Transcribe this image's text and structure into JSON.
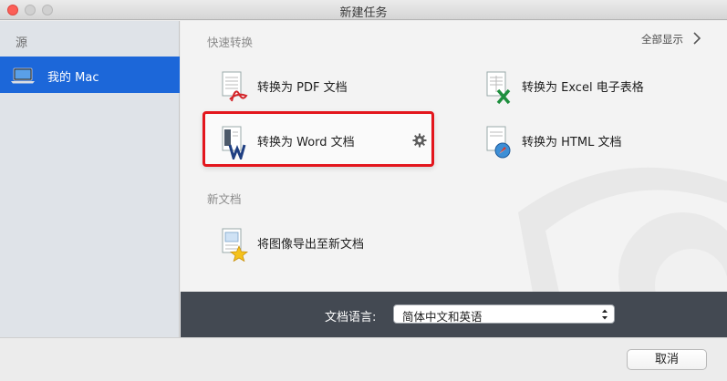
{
  "window": {
    "title": "新建任务"
  },
  "sidebar": {
    "header": "源",
    "items": [
      {
        "label": "我的 Mac",
        "icon": "macbook-icon",
        "selected": true
      }
    ]
  },
  "main": {
    "quick_convert": {
      "title": "快速转换",
      "show_all": "全部显示",
      "tasks": [
        {
          "label": "转换为 PDF 文档",
          "icon": "pdf-document-icon"
        },
        {
          "label": "转换为 Excel 电子表格",
          "icon": "excel-document-icon"
        },
        {
          "label": "转换为 Word 文档",
          "icon": "word-document-icon",
          "highlighted": true
        },
        {
          "label": "转换为 HTML 文档",
          "icon": "html-document-icon"
        }
      ]
    },
    "new_document": {
      "title": "新文档",
      "tasks": [
        {
          "label": "将图像导出至新文档",
          "icon": "image-export-icon"
        }
      ]
    }
  },
  "language": {
    "label": "文档语言:",
    "selected": "简体中文和英语"
  },
  "footer": {
    "cancel_label": "取消"
  },
  "colors": {
    "selection": "#1c67d9",
    "highlight_border": "#e3161d",
    "language_bar": "#434952"
  }
}
